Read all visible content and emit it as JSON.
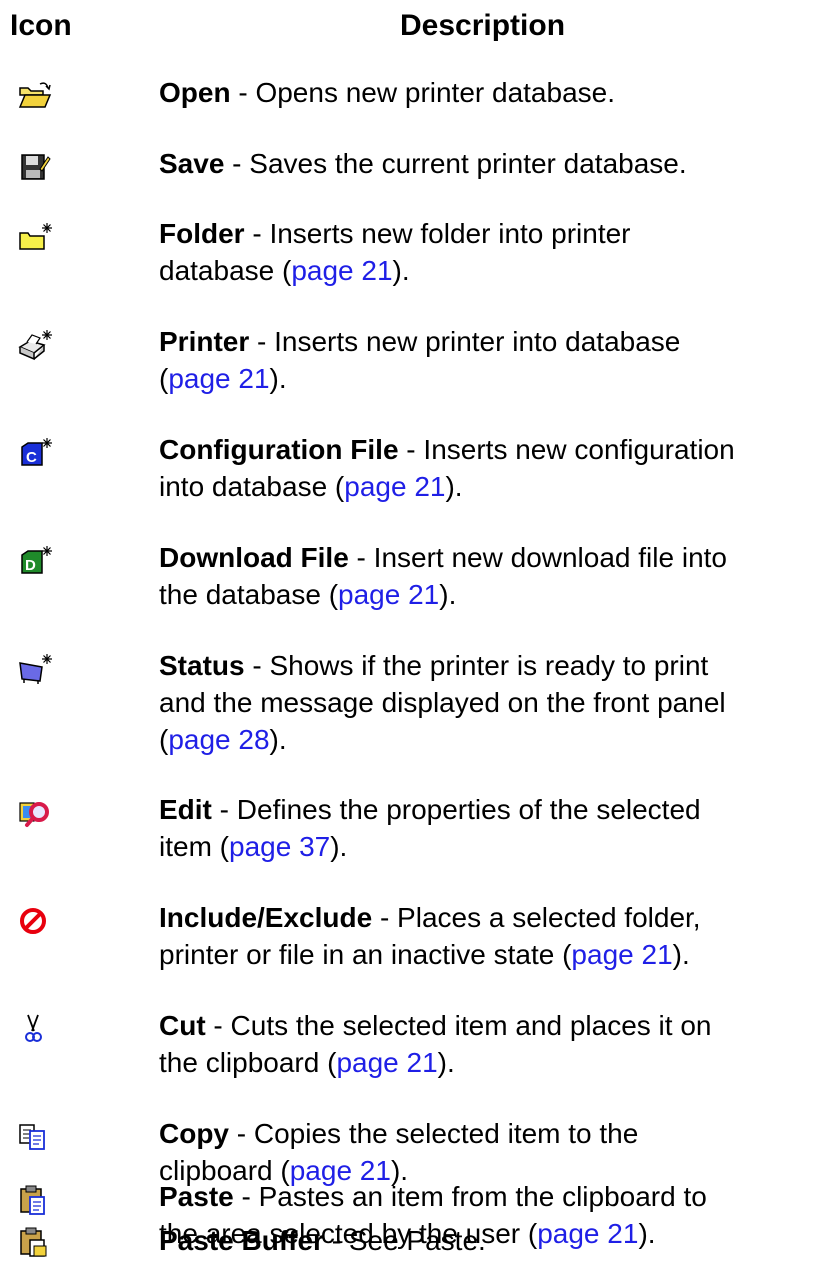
{
  "header": {
    "icon_col": "Icon",
    "desc_col": "Description"
  },
  "rows": [
    {
      "icon": "open-folder-icon",
      "name": "Open",
      "lines": [
        {
          "pre": " - Opens new printer database.",
          "link": "",
          "post": ""
        }
      ]
    },
    {
      "icon": "save-disk-icon",
      "name": "Save",
      "lines": [
        {
          "pre": " - Saves the current printer database.",
          "link": "",
          "post": ""
        }
      ]
    },
    {
      "icon": "new-folder-icon",
      "name": "Folder",
      "lines": [
        {
          "pre": " - Inserts new folder into printer",
          "link": "",
          "post": ""
        },
        {
          "pre": "database (",
          "link": "page 21",
          "post": ")."
        }
      ]
    },
    {
      "icon": "new-printer-icon",
      "name": "Printer",
      "lines": [
        {
          "pre": " - Inserts new printer into database",
          "link": "",
          "post": ""
        },
        {
          "pre": "(",
          "link": "page 21",
          "post": ")."
        }
      ]
    },
    {
      "icon": "configuration-file-icon",
      "name": "Configuration File",
      "lines": [
        {
          "pre": " - Inserts new configuration",
          "link": "",
          "post": ""
        },
        {
          "pre": "into database (",
          "link": "page 21",
          "post": ")."
        }
      ]
    },
    {
      "icon": "download-file-icon",
      "name": "Download File",
      "lines": [
        {
          "pre": " - Insert new download file into",
          "link": "",
          "post": ""
        },
        {
          "pre": "the database (",
          "link": "page 21",
          "post": ")."
        }
      ]
    },
    {
      "icon": "status-icon",
      "name": "Status",
      "lines": [
        {
          "pre": " - Shows if the printer is ready to print",
          "link": "",
          "post": ""
        },
        {
          "pre": "and the message displayed on the front panel",
          "link": "",
          "post": ""
        },
        {
          "pre": "(",
          "link": "page 28",
          "post": ")."
        }
      ]
    },
    {
      "icon": "edit-magnifier-icon",
      "name": "Edit",
      "lines": [
        {
          "pre": " - Defines the properties of the selected",
          "link": "",
          "post": ""
        },
        {
          "pre": "item (",
          "link": "page 37",
          "post": ")."
        }
      ]
    },
    {
      "icon": "include-exclude-icon",
      "name": "Include/Exclude",
      "lines": [
        {
          "pre": " - Places a selected folder,",
          "link": "",
          "post": ""
        },
        {
          "pre": "printer or file in an inactive state (",
          "link": "page 21",
          "post": ")."
        }
      ]
    },
    {
      "icon": "scissors-icon",
      "name": "Cut",
      "lines": [
        {
          "pre": " - Cuts the selected item and places it on",
          "link": "",
          "post": ""
        },
        {
          "pre": "the clipboard (",
          "link": "page 21",
          "post": ")."
        }
      ]
    },
    {
      "icon": "copy-icon",
      "name": "Copy",
      "lines": [
        {
          "pre": " - Copies the selected item to the",
          "link": "",
          "post": ""
        },
        {
          "pre": "clipboard (",
          "link": "page 21",
          "post": ")."
        }
      ]
    },
    {
      "icon": "paste-icon",
      "name": "Paste",
      "lines": [
        {
          "pre": " - Pastes an item from the clipboard to",
          "link": "",
          "post": ""
        },
        {
          "pre": "the area selected by the user (",
          "link": "page 21",
          "post": ")."
        }
      ]
    },
    {
      "icon": "paste-buffer-icon",
      "name": "Paste Buffer",
      "lines": [
        {
          "pre": " - See Paste.",
          "link": "",
          "post": ""
        }
      ]
    }
  ]
}
